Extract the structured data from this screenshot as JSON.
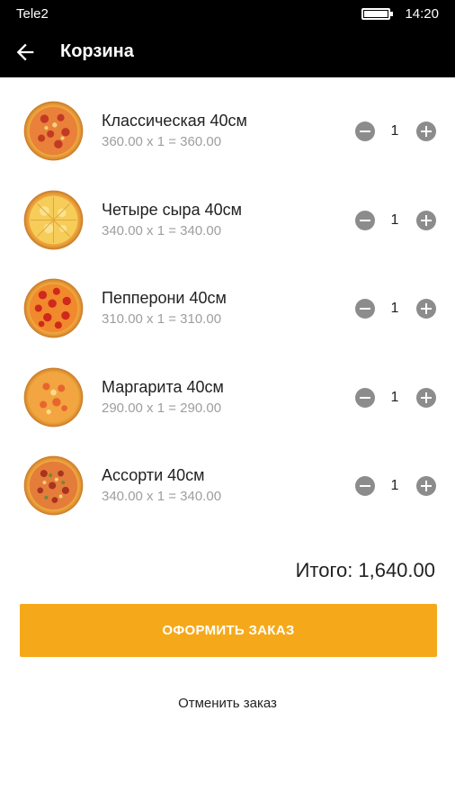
{
  "status_bar": {
    "carrier": "Tele2",
    "time": "14:20",
    "battery_icon": "battery-icon"
  },
  "app_bar": {
    "title": "Корзина",
    "back_icon": "arrow-back-icon"
  },
  "colors": {
    "accent": "#f5a91a",
    "app_bar": "#000000",
    "secondary_text": "#9e9e9e",
    "button_gray": "#8c8c8c"
  },
  "cart": {
    "items": [
      {
        "name": "Классическая 40см",
        "price_line": "360.00 x 1 = 360.00",
        "quantity": "1",
        "image_icon": "pizza-classic-icon"
      },
      {
        "name": "Четыре сыра 40см",
        "price_line": "340.00 x 1 = 340.00",
        "quantity": "1",
        "image_icon": "pizza-four-cheese-icon"
      },
      {
        "name": "Пепперони 40см",
        "price_line": "310.00 x 1 = 310.00",
        "quantity": "1",
        "image_icon": "pizza-pepperoni-icon"
      },
      {
        "name": "Маргарита 40см",
        "price_line": "290.00 x 1 = 290.00",
        "quantity": "1",
        "image_icon": "pizza-margherita-icon"
      },
      {
        "name": "Ассорти 40см",
        "price_line": "340.00 x 1 = 340.00",
        "quantity": "1",
        "image_icon": "pizza-assorti-icon"
      }
    ],
    "total_label": "Итого:",
    "total_value": "1,640.00"
  },
  "actions": {
    "checkout_label": "ОФОРМИТЬ ЗАКАЗ",
    "cancel_label": "Отменить заказ"
  }
}
